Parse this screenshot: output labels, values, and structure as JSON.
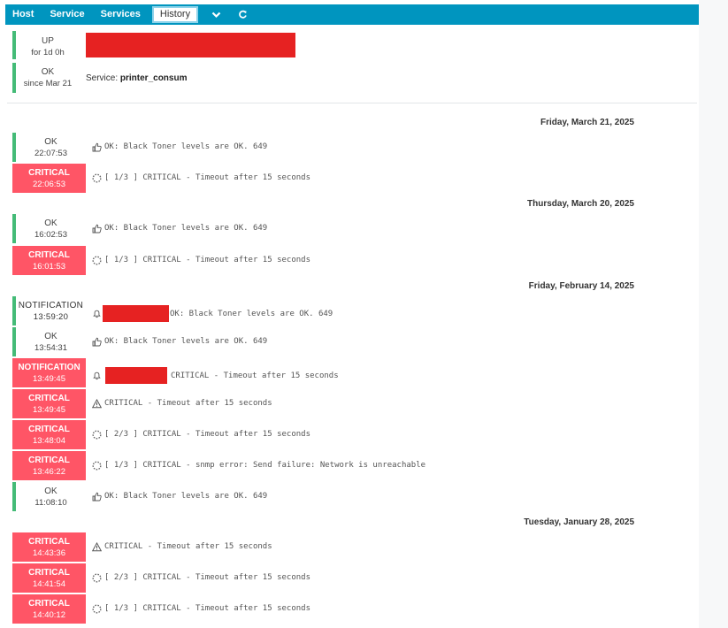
{
  "nav": {
    "host": "Host",
    "service": "Service",
    "services": "Services",
    "history": "History",
    "dropdown_icon": "chevron-down-icon",
    "refresh_icon": "refresh-icon"
  },
  "header": {
    "host_state": "UP",
    "host_since": "for 1d 0h",
    "service_state": "OK",
    "service_since": "since Mar 21",
    "service_prefix": "Service:",
    "service_name": "printer_consum"
  },
  "colors": {
    "accent": "#0095bf",
    "ok": "#44bb77",
    "critical": "#ff5566",
    "redaction": "#e62222"
  },
  "days": [
    {
      "date": "Friday, March 21, 2025",
      "events": [
        {
          "state": "OK",
          "time": "22:07:53",
          "kind": "ok",
          "icon": "thumbs-up-icon",
          "text": "OK: Black Toner levels are OK. 649"
        },
        {
          "state": "CRITICAL",
          "time": "22:06:53",
          "kind": "crit",
          "icon": "spinner-icon",
          "text": "[ 1/3 ] CRITICAL - Timeout after 15 seconds"
        }
      ]
    },
    {
      "date": "Thursday, March 20, 2025",
      "events": [
        {
          "state": "OK",
          "time": "16:02:53",
          "kind": "ok",
          "icon": "thumbs-up-icon",
          "text": "OK: Black Toner levels are OK. 649"
        },
        {
          "state": "CRITICAL",
          "time": "16:01:53",
          "kind": "crit",
          "icon": "spinner-icon",
          "text": "[ 1/3 ] CRITICAL - Timeout after 15 seconds"
        }
      ]
    },
    {
      "date": "Friday, February 14, 2025",
      "events": [
        {
          "state": "NOTIFICATION",
          "time": "13:59:20",
          "kind": "notif-ok",
          "icon": "bell-icon",
          "text": "OK: Black Toner levels are OK. 649"
        },
        {
          "state": "OK",
          "time": "13:54:31",
          "kind": "ok",
          "icon": "thumbs-up-icon",
          "text": "OK: Black Toner levels are OK. 649"
        },
        {
          "state": "NOTIFICATION",
          "time": "13:49:45",
          "kind": "notif-crit",
          "icon": "bell-icon",
          "text": "CRITICAL - Timeout after 15 seconds"
        },
        {
          "state": "CRITICAL",
          "time": "13:49:45",
          "kind": "crit",
          "icon": "warning-icon",
          "text": "CRITICAL - Timeout after 15 seconds"
        },
        {
          "state": "CRITICAL",
          "time": "13:48:04",
          "kind": "crit",
          "icon": "spinner-icon",
          "text": "[ 2/3 ] CRITICAL - Timeout after 15 seconds"
        },
        {
          "state": "CRITICAL",
          "time": "13:46:22",
          "kind": "crit",
          "icon": "spinner-icon",
          "text": "[ 1/3 ] CRITICAL - snmp error: Send failure: Network is unreachable"
        },
        {
          "state": "OK",
          "time": "11:08:10",
          "kind": "ok",
          "icon": "thumbs-up-icon",
          "text": "OK: Black Toner levels are OK. 649"
        }
      ]
    },
    {
      "date": "Tuesday, January 28, 2025",
      "events": [
        {
          "state": "CRITICAL",
          "time": "14:43:36",
          "kind": "crit",
          "icon": "warning-icon",
          "text": "CRITICAL - Timeout after 15 seconds"
        },
        {
          "state": "CRITICAL",
          "time": "14:41:54",
          "kind": "crit",
          "icon": "spinner-icon",
          "text": "[ 2/3 ] CRITICAL - Timeout after 15 seconds"
        },
        {
          "state": "CRITICAL",
          "time": "14:40:12",
          "kind": "crit",
          "icon": "spinner-icon",
          "text": "[ 1/3 ] CRITICAL - Timeout after 15 seconds"
        }
      ]
    }
  ]
}
